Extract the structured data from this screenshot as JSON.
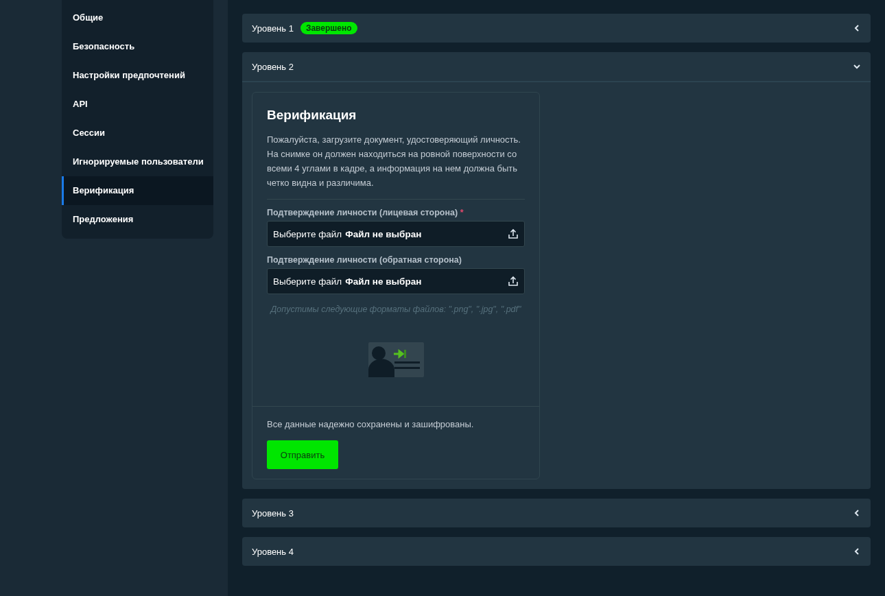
{
  "sidebar": {
    "items": [
      {
        "label": "Общие",
        "selected": false
      },
      {
        "label": "Безопасность",
        "selected": false
      },
      {
        "label": "Настройки предпочтений",
        "selected": false
      },
      {
        "label": "API",
        "selected": false
      },
      {
        "label": "Сессии",
        "selected": false
      },
      {
        "label": "Игнорируемые пользователи",
        "selected": false
      },
      {
        "label": "Верификация",
        "selected": true
      },
      {
        "label": "Предложения",
        "selected": false
      }
    ]
  },
  "levels": [
    {
      "title": "Уровень 1",
      "badge": "Завершено",
      "expanded": false
    },
    {
      "title": "Уровень 2",
      "expanded": true,
      "card": {
        "title": "Верификация",
        "description": "Пожалуйста, загрузите документ, удостоверяющий личность. На снимке он должен находиться на ровной поверхности со всеми 4 углами в кадре, а информация на нем должна быть четко видна и различима.",
        "fields": [
          {
            "label": "Подтверждение личности (лицевая сторона)",
            "required_mark": "*",
            "button_text": "Выберите файл",
            "status": "Файл не выбран"
          },
          {
            "label": "Подтверждение личности (обратная сторона)",
            "button_text": "Выберите файл",
            "status": "Файл не выбран"
          }
        ],
        "formats_hint": "Допустимы следующие форматы файлов: \".png\", \".jpg\", \".pdf\"",
        "footer_note": "Все данные надежно сохранены и зашифрованы.",
        "submit": "Отправить"
      }
    },
    {
      "title": "Уровень 3",
      "expanded": false
    },
    {
      "title": "Уровень 4",
      "expanded": false
    }
  ]
}
